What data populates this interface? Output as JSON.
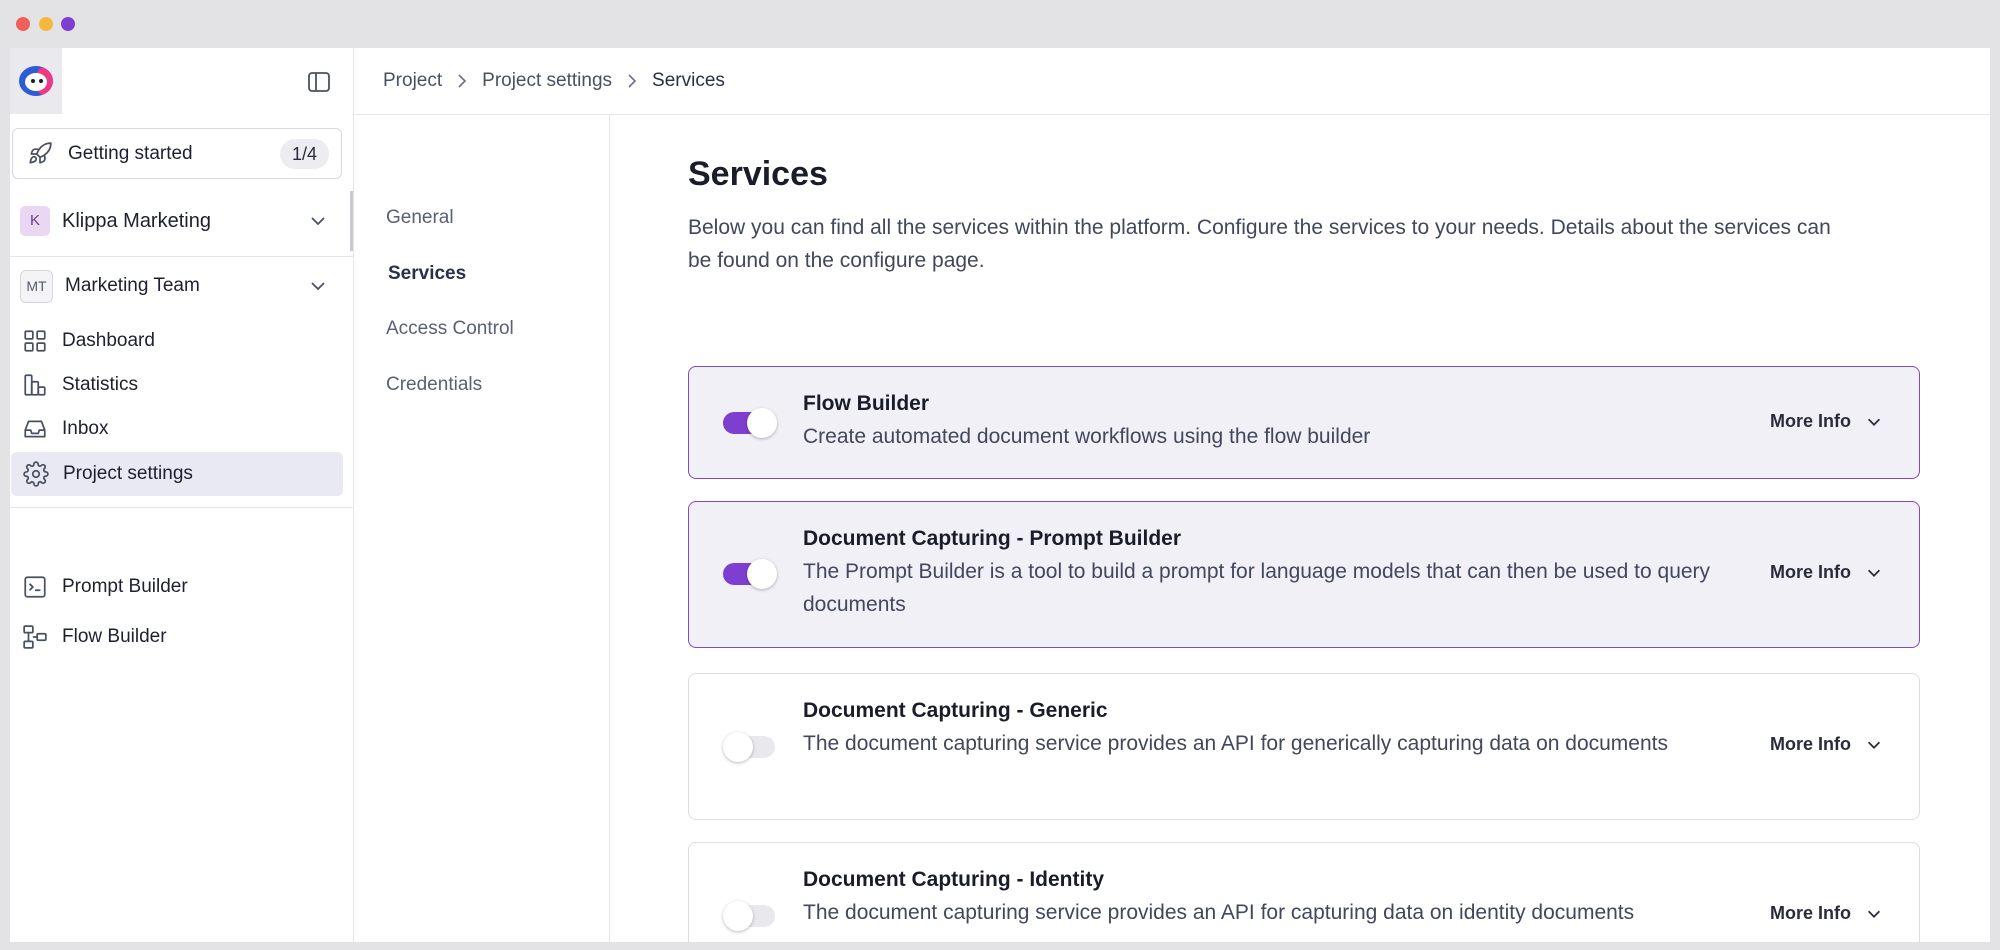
{
  "sidebar": {
    "getting_started": {
      "label": "Getting started",
      "progress": "1/4"
    },
    "org": {
      "initial": "K",
      "name": "Klippa Marketing"
    },
    "team": {
      "initials": "MT",
      "name": "Marketing Team"
    },
    "nav": [
      {
        "label": "Dashboard",
        "icon": "dashboard-icon"
      },
      {
        "label": "Statistics",
        "icon": "statistics-icon"
      },
      {
        "label": "Inbox",
        "icon": "inbox-icon"
      },
      {
        "label": "Project settings",
        "icon": "gear-icon",
        "active": true
      }
    ],
    "tools": [
      {
        "label": "Prompt Builder",
        "icon": "terminal-icon"
      },
      {
        "label": "Flow Builder",
        "icon": "flow-icon"
      }
    ]
  },
  "breadcrumb": [
    "Project",
    "Project settings",
    "Services"
  ],
  "subnav": [
    "General",
    "Services",
    "Access Control",
    "Credentials"
  ],
  "subnav_active": "Services",
  "page": {
    "title": "Services",
    "description": "Below you can find all the services within the platform. Configure the services to your needs. Details about the services can be found on the configure page."
  },
  "services": [
    {
      "title": "Flow Builder",
      "description": "Create automated document workflows using the flow builder",
      "enabled": true,
      "more_info": "More Info"
    },
    {
      "title": "Document Capturing - Prompt Builder",
      "description": "The Prompt Builder is a tool to build a prompt for language models that can then be used to query documents",
      "enabled": true,
      "more_info": "More Info"
    },
    {
      "title": "Document Capturing - Generic",
      "description": "The document capturing service provides an API for generically capturing data on documents",
      "enabled": false,
      "more_info": "More Info"
    },
    {
      "title": "Document Capturing - Identity",
      "description": "The document capturing service provides an API for capturing data on identity documents",
      "enabled": false,
      "more_info": "More Info"
    }
  ],
  "colors": {
    "accent": "#7e3fd0",
    "enabled_card_bg": "#f2f0f7",
    "active_nav_bg": "#e9e9f3"
  }
}
